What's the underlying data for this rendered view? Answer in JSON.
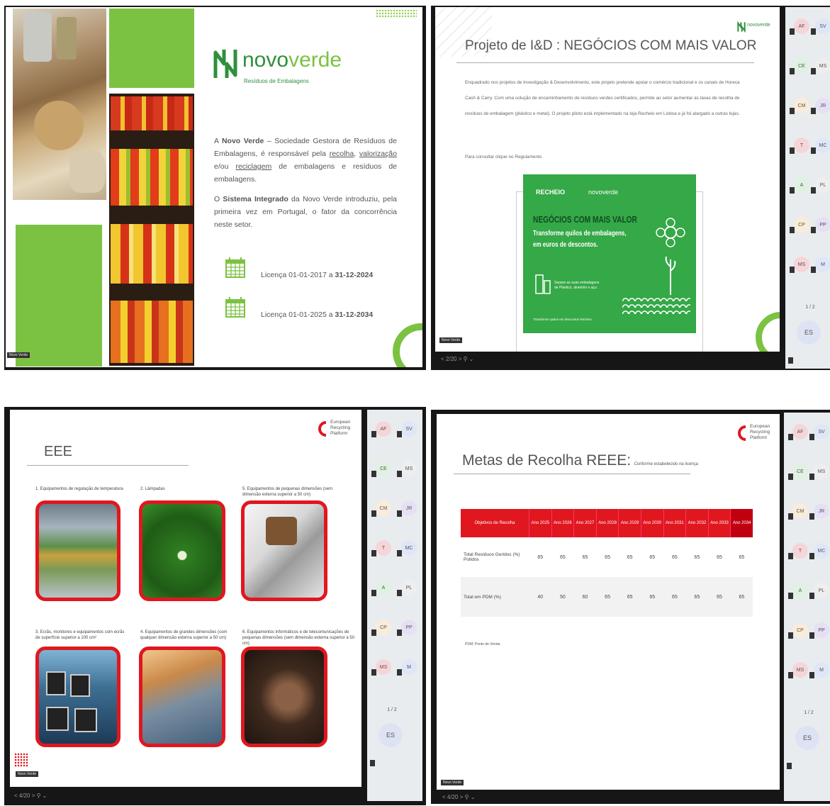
{
  "q1": {
    "logo_word_light": "novo",
    "logo_word_dark": "verde",
    "logo_subtitle": "Resíduos de Embalagens",
    "para1_a": "A ",
    "para1_bold": "Novo Verde",
    "para1_b": " – Sociedade Gestora de Resíduos de Embalagens, é responsável pela ",
    "para1_u1": "recolha",
    "para1_c": ", ",
    "para1_u2": "valorização",
    "para1_d": " e/ou ",
    "para1_u3": "reciclagem",
    "para1_e": " de embalagens e resíduos de embalagens.",
    "para2_a": "O ",
    "para2_bold": "Sistema Integrado",
    "para2_b": " da Novo Verde introduziu, pela primeira vez em Portugal, o fator da concorrência neste setor.",
    "lic1_prefix": "Licença 01-01-2017 a ",
    "lic1_bold": "31-12-2024",
    "lic2_prefix": "Licença 01-01-2025 a ",
    "lic2_bold": "31-12-2034",
    "presenter_badge": "Novo Verde"
  },
  "q2": {
    "title": "Projeto de I&D : NEGÓCIOS COM MAIS VALOR",
    "logo_word": "novoverde",
    "body": "Enquadrado nos projetos de Investigação & Desenvolvimento, este projeto pretende apoiar o comércio tradicional e os canais de Horeca Cash & Carry. Com uma solução de encaminhamento de resíduos verdes certificados, permite ao setor aumentar as taxas de recolha de resíduos de embalagem (plástico e metal). O projeto piloto está implementado na loja Recheio em Lisboa e já foi alargado a outras lojas.",
    "link_line": "Para consultar clique no Regulamento",
    "banner_logo1": "RECHEIO",
    "banner_logo2": "novoverde",
    "banner_title": "NEGÓCIOS COM MAIS VALOR",
    "banner_sub1": "Transforme quilos de embalagens,",
    "banner_sub2": "em euros de descontos.",
    "banner_small": "Separe as suas embalagens de Plástico, alumínio e aço.",
    "banner_footer": "Transforme quilos em descontos Recheio",
    "presenter_badge": "Novo Verde",
    "controls": "< 2/20 > ⚲ ⌄"
  },
  "q3": {
    "title": "EEE",
    "logo_line1": "European",
    "logo_line2": "Recycling",
    "logo_line3": "Platform",
    "items": [
      {
        "label": "1. Equipamentos de regulação de temperatura"
      },
      {
        "label": "2. Lâmpadas"
      },
      {
        "label": "5. Equipamentos de pequenas dimensões (sem dimensão externa superior a 50 cm)"
      },
      {
        "label": "3. Ecrãs, monitores e equipamentos com ecrãs de superfície superior a 100 cm²"
      },
      {
        "label": "4. Equipamentos de grandes dimensões (com qualquer dimensão externa superior a 50 cm)"
      },
      {
        "label": "6. Equipamentos informáticos e de telecomunicações de pequenas dimensões (sem dimensão externa superior a 50 cm)"
      }
    ],
    "presenter_badge": "Novo Verde",
    "controls": "< 4/20 > ⚲ ⌄"
  },
  "q4": {
    "title_big": "Metas de Recolha REEE:",
    "title_small": "Conforme estabelecido na licença",
    "logo_line1": "European",
    "logo_line2": "Recycling",
    "logo_line3": "Platform",
    "table": {
      "header_first": "Objetivos de Recolha",
      "years": [
        "Ano 2025",
        "Ano 2026",
        "Ano 2027",
        "Ano 2028",
        "Ano 2029",
        "Ano 2030",
        "Ano 2031",
        "Ano 2032",
        "Ano 2033",
        "Ano 2034"
      ],
      "rows": [
        {
          "label": "Total Resíduos Geridos (%) Potidos",
          "values": [
            "65",
            "65",
            "65",
            "65",
            "65",
            "65",
            "65",
            "65",
            "65",
            "65"
          ]
        },
        {
          "label": "Total em PDM (%)",
          "values": [
            "40",
            "50",
            "60",
            "65",
            "65",
            "65",
            "65",
            "65",
            "65",
            "65"
          ]
        }
      ],
      "note": "PDM: Ponto de Venda"
    },
    "presenter_badge": "Novo Verde",
    "controls": "< 4/20 > ⚲ ⌄"
  },
  "participants": {
    "initials": [
      "AF",
      "SV",
      "CE",
      "MS",
      "CM",
      "JR",
      "T",
      "MC",
      "A",
      "PL",
      "CP",
      "PP",
      "MS",
      "M"
    ],
    "page": "1 / 2",
    "self": "ES"
  }
}
